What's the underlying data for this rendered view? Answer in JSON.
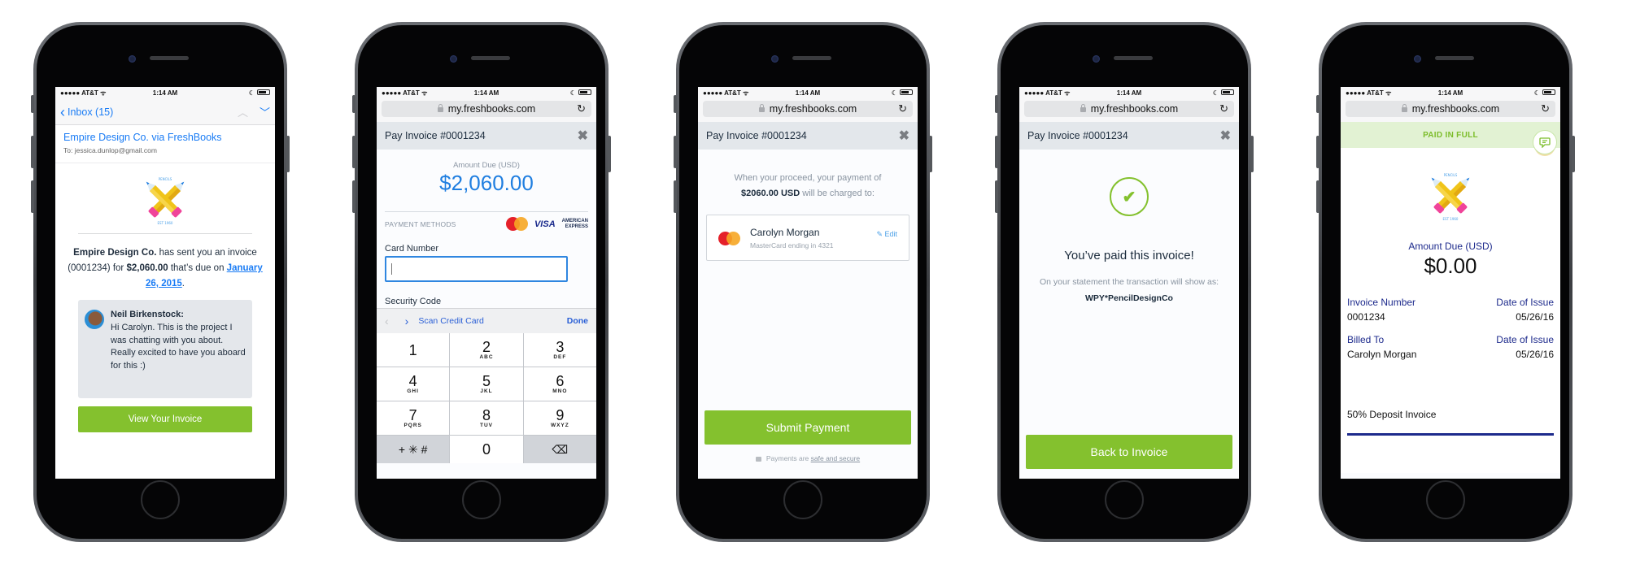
{
  "status_bar": {
    "carrier": "●●●●● AT&T",
    "wifi_icon": "ᯤ",
    "time": "1:14 AM",
    "moon_icon": "☾"
  },
  "browser": {
    "url": "my.freshbooks.com",
    "reload_icon": "↻"
  },
  "modal": {
    "title": "Pay Invoice #0001234",
    "close_icon": "✖"
  },
  "email": {
    "back_label": "Inbox (15)",
    "back_icon": "‹",
    "prev_icon": "︿",
    "next_icon": "﹀",
    "sender": "Empire Design Co. via FreshBooks",
    "to": "To: jessica.dunlop@gmail.com",
    "logo_top": "PENCILS",
    "logo_bottom": "EST 1960",
    "body_company": "Empire Design Co.",
    "body_text_1": " has sent you an invoice (0001234) for ",
    "body_amount": "$2,060.00",
    "body_text_2": " that’s due on ",
    "body_due": "January 26, 2015",
    "body_text_3": ".",
    "note_author": "Neil Birkenstock:",
    "note_message": "Hi Carolyn. This is the project I was chatting with you about. Really excited to have you aboard for this :)",
    "cta": "View Your Invoice"
  },
  "payment": {
    "amount_label": "Amount Due (USD)",
    "amount": "$2,060.00",
    "methods_label": "PAYMENT METHODS",
    "methods": [
      "MasterCard",
      "VISA",
      "AMERICAN EXPRESS"
    ],
    "visa": "VISA",
    "amex_1": "AMERICAN",
    "amex_2": "EXPRESS",
    "card_number_label": "Card Number",
    "card_number_value": "",
    "security_code_label": "Security Code",
    "toolbar": {
      "prev_icon": "‹",
      "next_icon": "›",
      "scan": "Scan Credit Card",
      "done": "Done"
    },
    "keys": [
      {
        "num": "1",
        "sub": ""
      },
      {
        "num": "2",
        "sub": "ABC"
      },
      {
        "num": "3",
        "sub": "DEF"
      },
      {
        "num": "4",
        "sub": "GHI"
      },
      {
        "num": "5",
        "sub": "JKL"
      },
      {
        "num": "6",
        "sub": "MNO"
      },
      {
        "num": "7",
        "sub": "PQRS"
      },
      {
        "num": "8",
        "sub": "TUV"
      },
      {
        "num": "9",
        "sub": "WXYZ"
      }
    ],
    "key_symbols": "+ ✳ #",
    "key_zero": "0",
    "key_delete": "⌫"
  },
  "confirm": {
    "text_1": "When your proceed, your payment of",
    "amount": "$2060.00 USD",
    "text_2": " will be charged to:",
    "card_name": "Carolyn Morgan",
    "card_sub": "MasterCard ending in 4321",
    "edit": "✎ Edit",
    "submit": "Submit Payment",
    "secure_prefix": "Payments are ",
    "secure_link": "safe and secure"
  },
  "paid": {
    "check_icon": "✔",
    "title": "You’ve paid this invoice!",
    "sub": "On your statement the transaction will show as: ",
    "descriptor": "WPY*PencilDesignCo",
    "back": "Back to Invoice"
  },
  "invoice": {
    "banner": "PAID IN FULL",
    "chat_icon": "💬",
    "amount_label": "Amount Due (USD)",
    "amount": "$0.00",
    "invoice_number_label": "Invoice Number",
    "invoice_number": "0001234",
    "date_label_1": "Date of Issue",
    "date_1": "05/26/16",
    "billed_to_label": "Billed To",
    "billed_to": "Carolyn Morgan",
    "date_label_2": "Date of Issue",
    "date_2": "05/26/16",
    "deposit": "50% Deposit Invoice"
  },
  "colors": {
    "brand_green": "#84c12e",
    "link_blue": "#1a7cf5",
    "navy": "#1d2a8c",
    "pencil_yellow": "#f0c419",
    "eraser_pink": "#f0449a"
  }
}
